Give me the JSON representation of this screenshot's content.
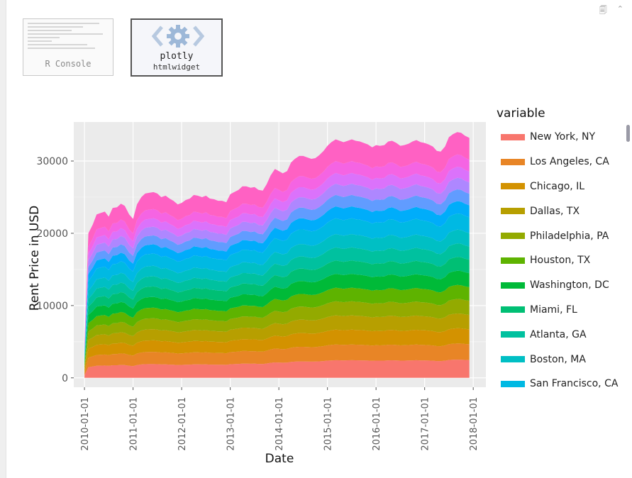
{
  "top_icons": {
    "icon1": "🗐",
    "icon2": "⌃"
  },
  "thumbnails": {
    "console": {
      "label": "R Console"
    },
    "plotly": {
      "title": "plotly",
      "subtitle": "htmlwidget"
    }
  },
  "legend": {
    "title": "variable"
  },
  "chart_data": {
    "type": "area",
    "stacked": true,
    "xlabel": "Date",
    "ylabel": "Rent Price in USD",
    "x_ticks": [
      "2010-01-01",
      "2011-01-01",
      "2012-01-01",
      "2013-01-01",
      "2014-01-01",
      "2015-01-01",
      "2016-01-01",
      "2017-01-01",
      "2018-01-01"
    ],
    "y_ticks": [
      0,
      10000,
      20000,
      30000
    ],
    "ylim": [
      -1300,
      35400
    ],
    "xlim": [
      2009.78,
      2018.26
    ],
    "grid": true,
    "legend_position": "right",
    "x": [
      2010.0,
      2010.08,
      2010.17,
      2010.25,
      2010.33,
      2010.42,
      2010.5,
      2010.58,
      2010.67,
      2010.75,
      2010.83,
      2010.92,
      2011.0,
      2011.08,
      2011.17,
      2011.25,
      2011.33,
      2011.42,
      2011.5,
      2011.58,
      2011.67,
      2011.75,
      2011.83,
      2011.92,
      2012.0,
      2012.08,
      2012.17,
      2012.25,
      2012.33,
      2012.42,
      2012.5,
      2012.58,
      2012.67,
      2012.75,
      2012.83,
      2012.92,
      2013.0,
      2013.08,
      2013.17,
      2013.25,
      2013.33,
      2013.42,
      2013.5,
      2013.58,
      2013.67,
      2013.75,
      2013.83,
      2013.92,
      2014.0,
      2014.08,
      2014.17,
      2014.25,
      2014.33,
      2014.42,
      2014.5,
      2014.58,
      2014.67,
      2014.75,
      2014.83,
      2014.92,
      2015.0,
      2015.08,
      2015.17,
      2015.25,
      2015.33,
      2015.42,
      2015.5,
      2015.58,
      2015.67,
      2015.75,
      2015.83,
      2015.92,
      2016.0,
      2016.08,
      2016.17,
      2016.25,
      2016.33,
      2016.42,
      2016.5,
      2016.58,
      2016.67,
      2016.75,
      2016.83,
      2016.92,
      2017.0,
      2017.08,
      2017.17,
      2017.25,
      2017.33,
      2017.42,
      2017.5,
      2017.58,
      2017.67,
      2017.75,
      2017.83,
      2017.92
    ],
    "totals": [
      4800,
      20000,
      21200,
      22600,
      22800,
      23000,
      22300,
      23500,
      23600,
      24100,
      23800,
      22600,
      22000,
      24000,
      25000,
      25500,
      25600,
      25700,
      25500,
      25000,
      25200,
      24800,
      24500,
      24000,
      24200,
      24600,
      24800,
      25300,
      25200,
      25000,
      25200,
      24800,
      24700,
      24500,
      24500,
      24300,
      25400,
      25700,
      26000,
      26500,
      26500,
      26300,
      26400,
      26000,
      25900,
      26800,
      28000,
      28900,
      28600,
      28300,
      28600,
      29800,
      30300,
      30700,
      30700,
      30500,
      30300,
      30400,
      30800,
      31400,
      32100,
      32600,
      33000,
      32800,
      32600,
      32800,
      33000,
      32800,
      32700,
      32500,
      32300,
      31900,
      32200,
      32100,
      32200,
      32700,
      32800,
      32500,
      32100,
      32200,
      32400,
      32700,
      32900,
      32600,
      32500,
      32300,
      32000,
      31400,
      31300,
      32000,
      33300,
      33700,
      34000,
      33900,
      33500,
      33200
    ],
    "series": [
      {
        "name": "New York, NY",
        "color": "#F8766D",
        "share": 0.074
      },
      {
        "name": "Los Angeles, CA",
        "color": "#E88526",
        "share": 0.066
      },
      {
        "name": "Chicago, IL",
        "color": "#D39200",
        "share": 0.062
      },
      {
        "name": "Dallas, TX",
        "color": "#B79F00",
        "share": 0.06
      },
      {
        "name": "Philadelphia, PA",
        "color": "#93AA00",
        "share": 0.059
      },
      {
        "name": "Houston, TX",
        "color": "#5EB300",
        "share": 0.057
      },
      {
        "name": "Washington, DC",
        "color": "#00BA38",
        "share": 0.058
      },
      {
        "name": "Miami, FL",
        "color": "#00BF74",
        "share": 0.056
      },
      {
        "name": "Atlanta, GA",
        "color": "#00C19F",
        "share": 0.055
      },
      {
        "name": "Boston, MA",
        "color": "#00BFC4",
        "share": 0.056
      },
      {
        "name": "San Francisco, CA",
        "color": "#00B9E3",
        "share": 0.066
      },
      {
        "name": "",
        "color": "#00ADFA",
        "share": 0.05
      },
      {
        "name": "",
        "color": "#619CFF",
        "share": 0.048
      },
      {
        "name": "",
        "color": "#AE87FF",
        "share": 0.047
      },
      {
        "name": "",
        "color": "#DB72FB",
        "share": 0.045
      },
      {
        "name": "",
        "color": "#F564E3",
        "share": 0.05
      },
      {
        "name": "",
        "color": "#FF61C3",
        "share": 0.091
      }
    ],
    "legend_visible_count": 11
  }
}
